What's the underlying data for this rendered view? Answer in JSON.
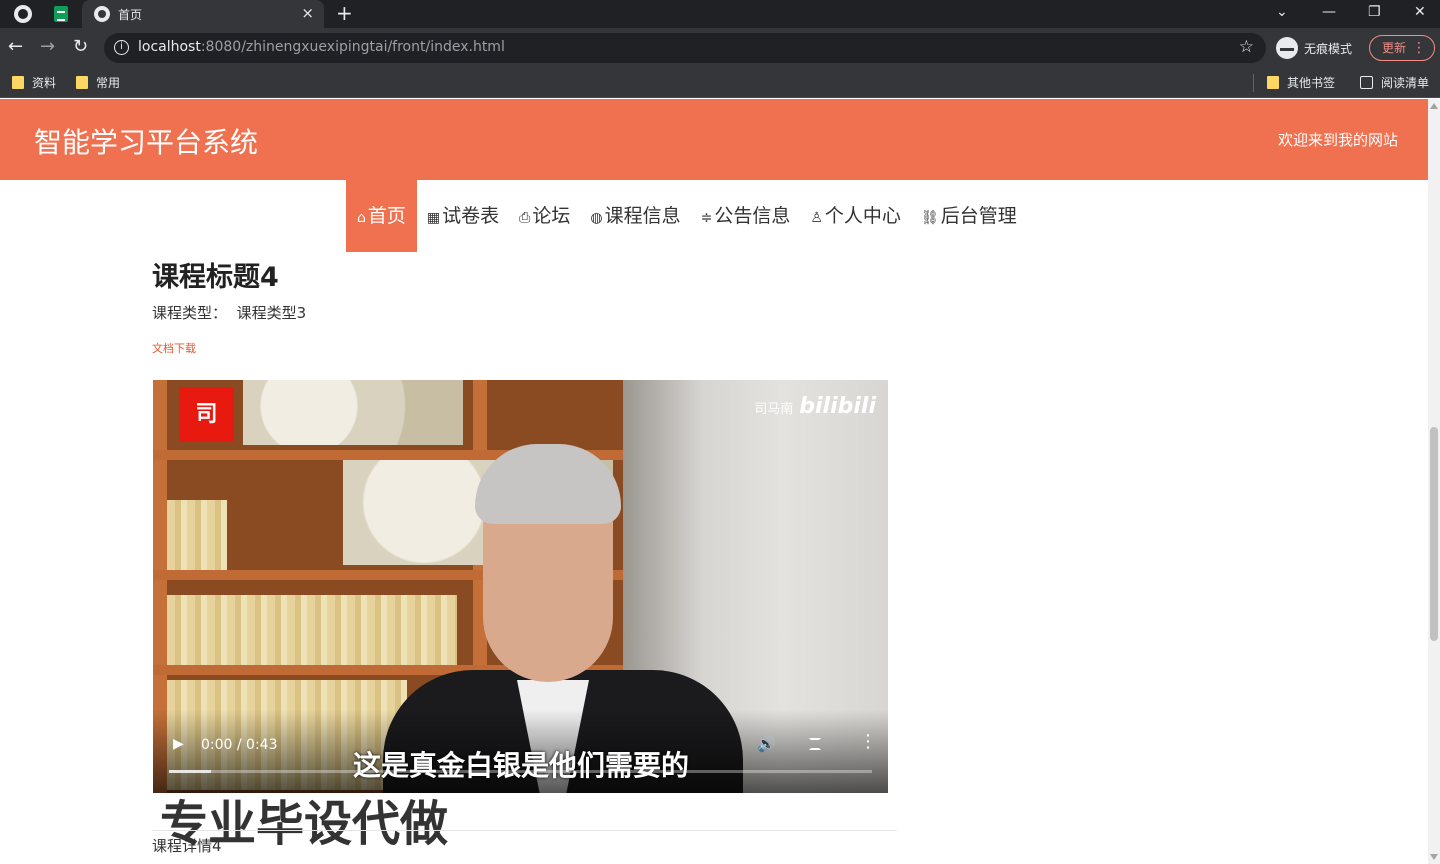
{
  "browser": {
    "tab_title": "首页",
    "tab_close": "×",
    "new_tab": "+",
    "url_host": "localhost",
    "url_rest": ":8080/zhinengxuexipingtai/front/index.html",
    "incognito_label": "无痕模式",
    "update_label": "更新",
    "bookmarks": [
      "资料",
      "常用"
    ],
    "other_bookmarks": "其他书签",
    "reading_list": "阅读清单"
  },
  "site": {
    "title": "智能学习平台系统",
    "welcome": "欢迎来到我的网站",
    "accent_color": "#ef7150"
  },
  "nav": {
    "items": [
      {
        "label": "首页",
        "icon": "home-icon",
        "active": true
      },
      {
        "label": "试卷表",
        "icon": "grid-icon"
      },
      {
        "label": "论坛",
        "icon": "printer-icon"
      },
      {
        "label": "课程信息",
        "icon": "globe-icon"
      },
      {
        "label": "公告信息",
        "icon": "sliders-icon"
      },
      {
        "label": "个人中心",
        "icon": "user-icon"
      },
      {
        "label": "后台管理",
        "icon": "link-icon"
      }
    ]
  },
  "course": {
    "title": "课程标题4",
    "type_label": "课程类型：",
    "type_value": "课程类型3",
    "download_link": "文档下载",
    "detail": "课程详情4"
  },
  "video": {
    "time": "0:00 / 0:43",
    "progress": 0.06,
    "logo_text": "司",
    "watermark_name": "司马南",
    "watermark_brand": "bilibili",
    "subtitle": "这是真金白银是他们需要的"
  },
  "overlay": {
    "text": "专业毕设代做"
  }
}
